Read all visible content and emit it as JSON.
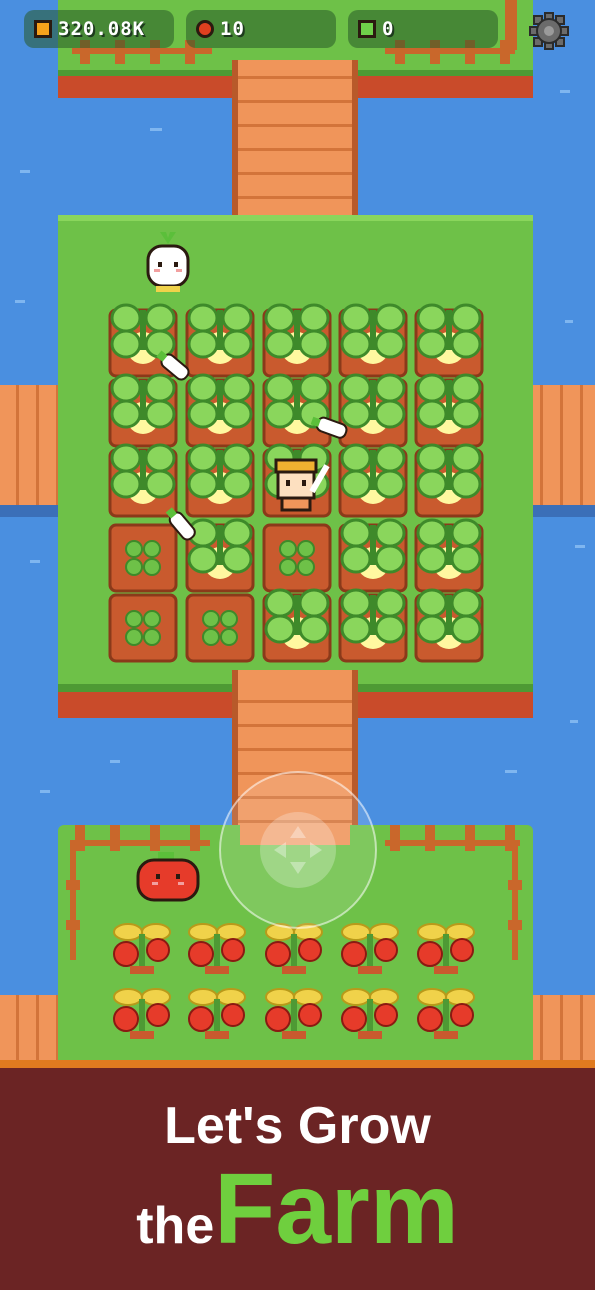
{
  "hud": {
    "gold": {
      "value": "320.08K",
      "icon": "gold-coin-icon",
      "color": "#f7a21b"
    },
    "gems": {
      "value": "10",
      "icon": "red-gem-icon",
      "color": "#e0401f"
    },
    "seeds": {
      "value": "0",
      "icon": "green-seed-icon",
      "color": "#6fd04a"
    },
    "settings_icon": "gear-icon"
  },
  "banner": {
    "line1": "Let's Grow",
    "line2_prefix": "the",
    "line2_highlight": "Farm",
    "highlight_color": "#6fcf3e",
    "background": "#6b2424"
  },
  "farm": {
    "turnip_plots": [
      [
        "grown",
        "grown",
        "grown",
        "grown",
        "grown"
      ],
      [
        "grown",
        "grown",
        "grown",
        "grown",
        "grown"
      ],
      [
        "grown",
        "grown",
        "grown",
        "grown",
        "grown"
      ],
      [
        "sprout",
        "grown",
        "sprout",
        "grown",
        "grown"
      ],
      [
        "sprout",
        "sprout",
        "grown",
        "grown",
        "grown"
      ]
    ],
    "tomato_rows": 2,
    "tomato_cols": 5
  },
  "characters": [
    "turnip-npc",
    "farmer-player",
    "tomato-npc"
  ],
  "joystick_icon": "virtual-joystick"
}
